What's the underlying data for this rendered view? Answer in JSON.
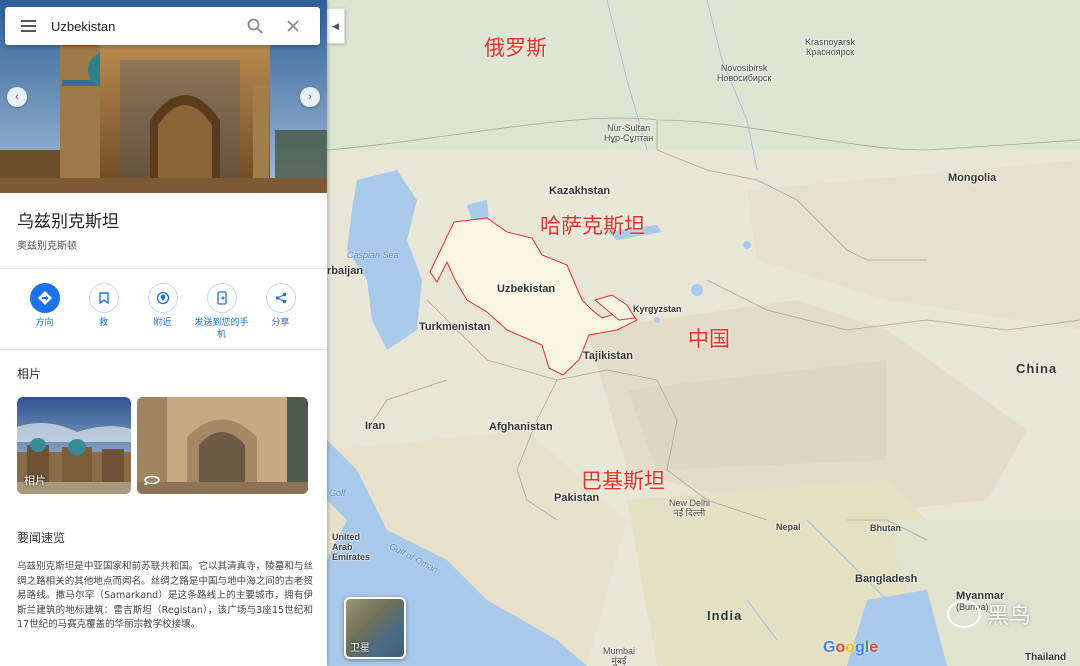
{
  "search": {
    "query": "Uzbekistan"
  },
  "place": {
    "title": "乌兹别克斯坦",
    "subtitle": "奥兹别克斯顿"
  },
  "actions": [
    {
      "label": "方向",
      "icon": "directions-icon"
    },
    {
      "label": "救",
      "icon": "bookmark-icon"
    },
    {
      "label": "附近",
      "icon": "nearby-icon"
    },
    {
      "label": "发送到您的手机",
      "icon": "send-to-phone-icon"
    },
    {
      "label": "分享",
      "icon": "share-icon"
    }
  ],
  "photos_section": {
    "heading": "相片",
    "items": [
      {
        "caption": "相片"
      },
      {
        "caption": ""
      }
    ]
  },
  "overview": {
    "heading": "要闻速览",
    "text": "乌兹别克斯坦是中亚国家和前苏联共和国。它以其清真寺，陵墓和与丝绸之路相关的其他地点而闻名。丝绸之路是中国与地中海之间的古老贸易路线。撒马尔罕（Samarkand）是这条路线上的主要城市，拥有伊斯兰建筑的地标建筑：雷吉斯坦（Registan），该广场与3座15世纪和17世纪的马赛克覆盖的华丽宗教学校接壤。"
  },
  "map": {
    "labels": {
      "russia_cn": "俄罗斯",
      "kazakhstan_cn": "哈萨克斯坦",
      "china_cn": "中国",
      "pakistan_cn": "巴基斯坦",
      "novosibirsk": "Novosibirsk",
      "novosibirsk_ru": "Новосибирск",
      "krasnoyarsk": "Krasnoyarsk",
      "krasnoyarsk_ru": "Красноярск",
      "nur_sultan": "Nur-Sultan",
      "nur_sultan_kz": "Нұр-Сұлтан",
      "kazakhstan": "Kazakhstan",
      "mongolia": "Mongolia",
      "caspian_sea": "Caspian Sea",
      "azerbaijan": "rbaijan",
      "uzbekistan": "Uzbekistan",
      "kyrgyzstan": "Kyrgyzstan",
      "turkmenistan": "Turkmenistan",
      "tajikistan": "Tajikistan",
      "china": "China",
      "iran": "Iran",
      "afghanistan": "Afghanistan",
      "pakistan": "Pakistan",
      "new_delhi": "New Delhi",
      "new_delhi_hi": "नई दिल्ली",
      "nepal": "Nepal",
      "bhutan": "Bhutan",
      "bangladesh": "Bangladesh",
      "india": "India",
      "myanmar": "Myanmar",
      "myanmar_sub": "(Burma)",
      "thailand": "Thailand",
      "uae": "United Arab Emirates",
      "gulf_of_oman": "Gulf of Oman",
      "gulf": "Golf",
      "mumbai": "Mumbai",
      "mumbai_hi": "मुंबई"
    },
    "satellite_label": "卫星",
    "google_logo": [
      "G",
      "o",
      "o",
      "g",
      "l",
      "e"
    ],
    "watermark": "黑鸟"
  }
}
